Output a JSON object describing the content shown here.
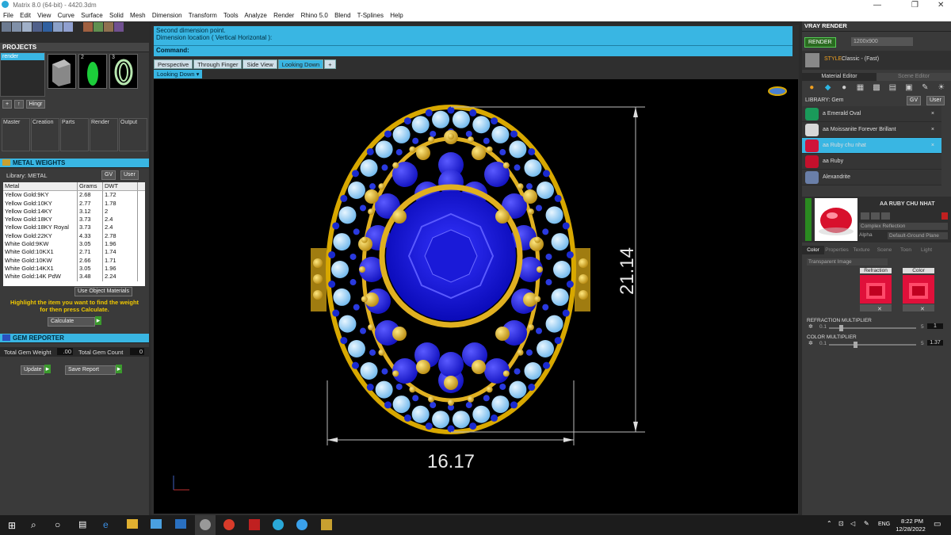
{
  "window": {
    "title": "Matrix 8.0 (64-bit) - 4420.3dm",
    "min_glyph": "—",
    "max_glyph": "❐",
    "close_glyph": "✕"
  },
  "menu": [
    "File",
    "Edit",
    "View",
    "Curve",
    "Surface",
    "Solid",
    "Mesh",
    "Dimension",
    "Transform",
    "Tools",
    "Analyze",
    "Render",
    "Rhino 5.0",
    "Blend",
    "T-Splines",
    "Help"
  ],
  "projects": {
    "title": "PROJECTS",
    "item": "render",
    "thumbs": [
      "",
      "2",
      "3"
    ],
    "hingr_label": "Hingr"
  },
  "tabs_left": [
    "Master",
    "Creation",
    "Parts",
    "Render",
    "Output"
  ],
  "metal_weights": {
    "title": "METAL WEIGHTS",
    "library_label": "Library: METAL",
    "gv_label": "GV",
    "user_label": "User",
    "columns": [
      "Metal",
      "Grams",
      "DWT"
    ],
    "rows": [
      [
        "Yellow Gold:9KY",
        "2.68",
        "1.72"
      ],
      [
        "Yellow Gold:10KY",
        "2.77",
        "1.78"
      ],
      [
        "Yellow Gold:14KY",
        "3.12",
        "2"
      ],
      [
        "Yellow Gold:18KY",
        "3.73",
        "2.4"
      ],
      [
        "Yellow Gold:18KY Royal",
        "3.73",
        "2.4"
      ],
      [
        "Yellow Gold:22KY",
        "4.33",
        "2.78"
      ],
      [
        "White Gold:9KW",
        "3.05",
        "1.96"
      ],
      [
        "White Gold:10KX1",
        "2.71",
        "1.74"
      ],
      [
        "White Gold:10KW",
        "2.66",
        "1.71"
      ],
      [
        "White Gold:14KX1",
        "3.05",
        "1.96"
      ],
      [
        "White Gold:14K PdW",
        "3.48",
        "2.24"
      ]
    ],
    "use_object_materials": "Use Object Materials",
    "hint": "Highlight the item you want to find the weight for then press Calculate.",
    "calculate": "Calculate"
  },
  "gem_reporter": {
    "title": "GEM REPORTER",
    "total_weight_label": "Total Gem Weight",
    "total_weight_value": ".00",
    "total_count_label": "Total Gem Count",
    "total_count_value": "0",
    "update": "Update",
    "save_report": "Save Report"
  },
  "command": {
    "line1": "Second dimension point.",
    "line2": "Dimension location ( Vertical  Horizontal ):",
    "prompt": "Command:"
  },
  "view_tabs": [
    "Perspective",
    "Through Finger",
    "Side View",
    "Looking Down"
  ],
  "active_view": "Looking Down",
  "view_select": "Looking Down",
  "dimensions": {
    "height": "21.14",
    "width": "16.17"
  },
  "vray": {
    "title": "VRAY RENDER",
    "render_label": "RENDER",
    "resolution": "1200x900",
    "style_label": "STYLE:",
    "style_value": "Classic - (Fast)",
    "editor_tabs": [
      "Material Editor",
      "Scene Editor"
    ],
    "library_label": "LIBRARY: Gem",
    "gv_label": "GV",
    "user_label": "User",
    "materials": [
      {
        "name": "a Emerald Oval",
        "color": "#1a9a5a"
      },
      {
        "name": "aa Moissanite Forever Brillant",
        "color": "#d8d8d8"
      },
      {
        "name": "aa Ruby chu nhat",
        "color": "#d0143a"
      },
      {
        "name": "aa Ruby",
        "color": "#c4102c"
      },
      {
        "name": "Alexandrite",
        "color": "#6a7fa8"
      }
    ],
    "selected_material": "AA RUBY CHU NHAT",
    "reflection": "Complex Reflection",
    "alpha_label": "Alpha",
    "ground_plane": "Default-Ground Plane",
    "prop_tabs": [
      "Color",
      "Properties",
      "Texture",
      "Scene",
      "Toon",
      "Light"
    ],
    "transparent": "Transparent Image",
    "refraction_label": "Refraction",
    "color_label": "Color",
    "refraction_multiplier": {
      "label": "REFRACTION MULTIPLIER",
      "min": "0.1",
      "max": "5",
      "value": "1",
      "fraction": 0.12
    },
    "color_multiplier": {
      "label": "COLOR MULTIPLIER",
      "min": "0.1",
      "max": "5",
      "value": "1.37",
      "fraction": 0.28
    }
  },
  "taskbar": {
    "lang": "ENG",
    "time": "8:22 PM",
    "date": "12/28/2022"
  }
}
